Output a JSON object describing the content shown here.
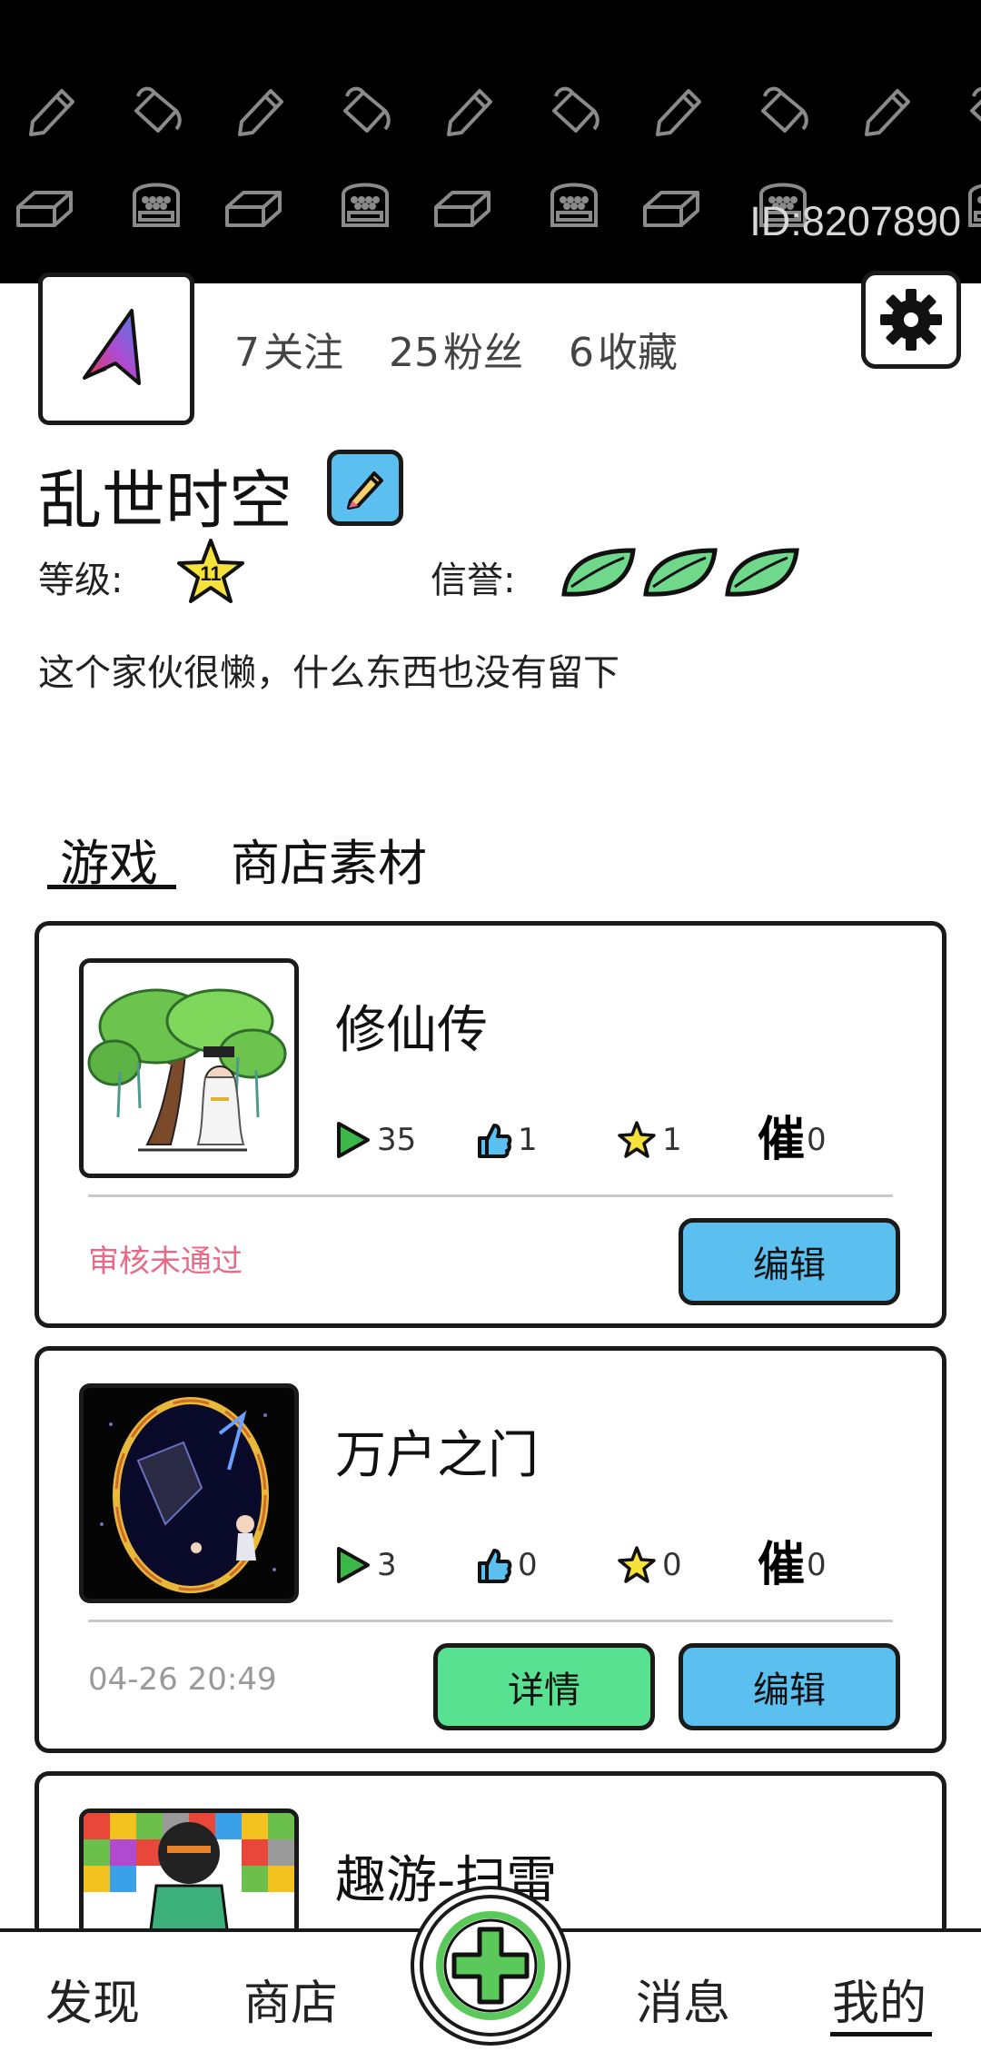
{
  "banner": {
    "user_id": "ID:8207890"
  },
  "profile": {
    "stats": [
      {
        "count": "7",
        "label": "关注"
      },
      {
        "count": "25",
        "label": "粉丝"
      },
      {
        "count": "6",
        "label": "收藏"
      }
    ],
    "username": "乱世时空",
    "level_label": "等级:",
    "level_value": "11",
    "credit_label": "信誉:",
    "credit_leaves": 3,
    "bio": "这个家伙很懒，什么东西也没有留下"
  },
  "tabs": [
    {
      "label": "游戏",
      "active": true
    },
    {
      "label": "商店素材",
      "active": false
    }
  ],
  "games": [
    {
      "title": "修仙传",
      "plays": "35",
      "likes": "1",
      "stars": "1",
      "urge_label": "催",
      "urges": "0",
      "status": "审核未通过",
      "edit_label": "编辑"
    },
    {
      "title": "万户之门",
      "plays": "3",
      "likes": "0",
      "stars": "0",
      "urge_label": "催",
      "urges": "0",
      "timestamp": "04-26 20:49",
      "detail_label": "详情",
      "edit_label": "编辑"
    },
    {
      "title": "趣游-扫雷"
    }
  ],
  "nav": {
    "discover": "发现",
    "shop": "商店",
    "messages": "消息",
    "mine": "我的"
  },
  "colors": {
    "edit_button": "#5bc0f0",
    "detail_button": "#58e190",
    "status_rejected": "#e76a88",
    "create_green": "#5bc85a"
  }
}
